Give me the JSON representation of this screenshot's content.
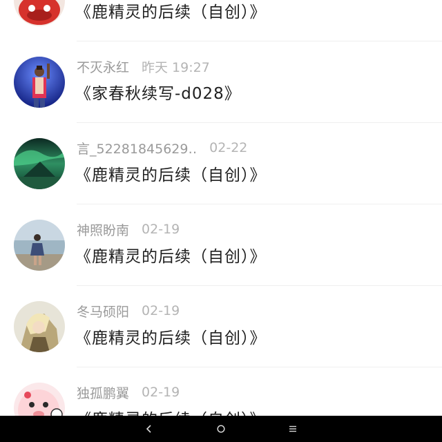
{
  "messages": [
    {
      "name": "",
      "time": "",
      "title": "《鹿精灵的后续（自创）》",
      "avatar_icon": "red-cartoon-avatar-icon"
    },
    {
      "name": "不灭永红",
      "time": "昨天 19:27",
      "title": "《家春秋续写-d028》",
      "avatar_icon": "performer-photo-avatar-icon"
    },
    {
      "name": "言_52281845629‥",
      "time": "02-22",
      "title": "《鹿精灵的后续（自创）》",
      "avatar_icon": "aurora-mountain-avatar-icon"
    },
    {
      "name": "神照盼南",
      "time": "02-19",
      "title": "《鹿精灵的后续（自创）》",
      "avatar_icon": "beach-person-avatar-icon"
    },
    {
      "name": "冬马硕阳",
      "time": "02-19",
      "title": "《鹿精灵的后续（自创）》",
      "avatar_icon": "anime-character-avatar-icon"
    },
    {
      "name": "独孤鹏翼",
      "time": "02-19",
      "title": "《鹿精灵的后续（自创）》",
      "avatar_icon": "pink-cartoon-face-avatar-icon"
    }
  ],
  "navbar": {
    "icons": [
      "back-chevron-icon",
      "home-circle-icon",
      "recents-menu-icon"
    ],
    "background": "#000000"
  },
  "colors": {
    "name": "#9a9a9a",
    "time": "#b4b4b4",
    "title": "#1f1f1f",
    "divider": "#efefef"
  }
}
